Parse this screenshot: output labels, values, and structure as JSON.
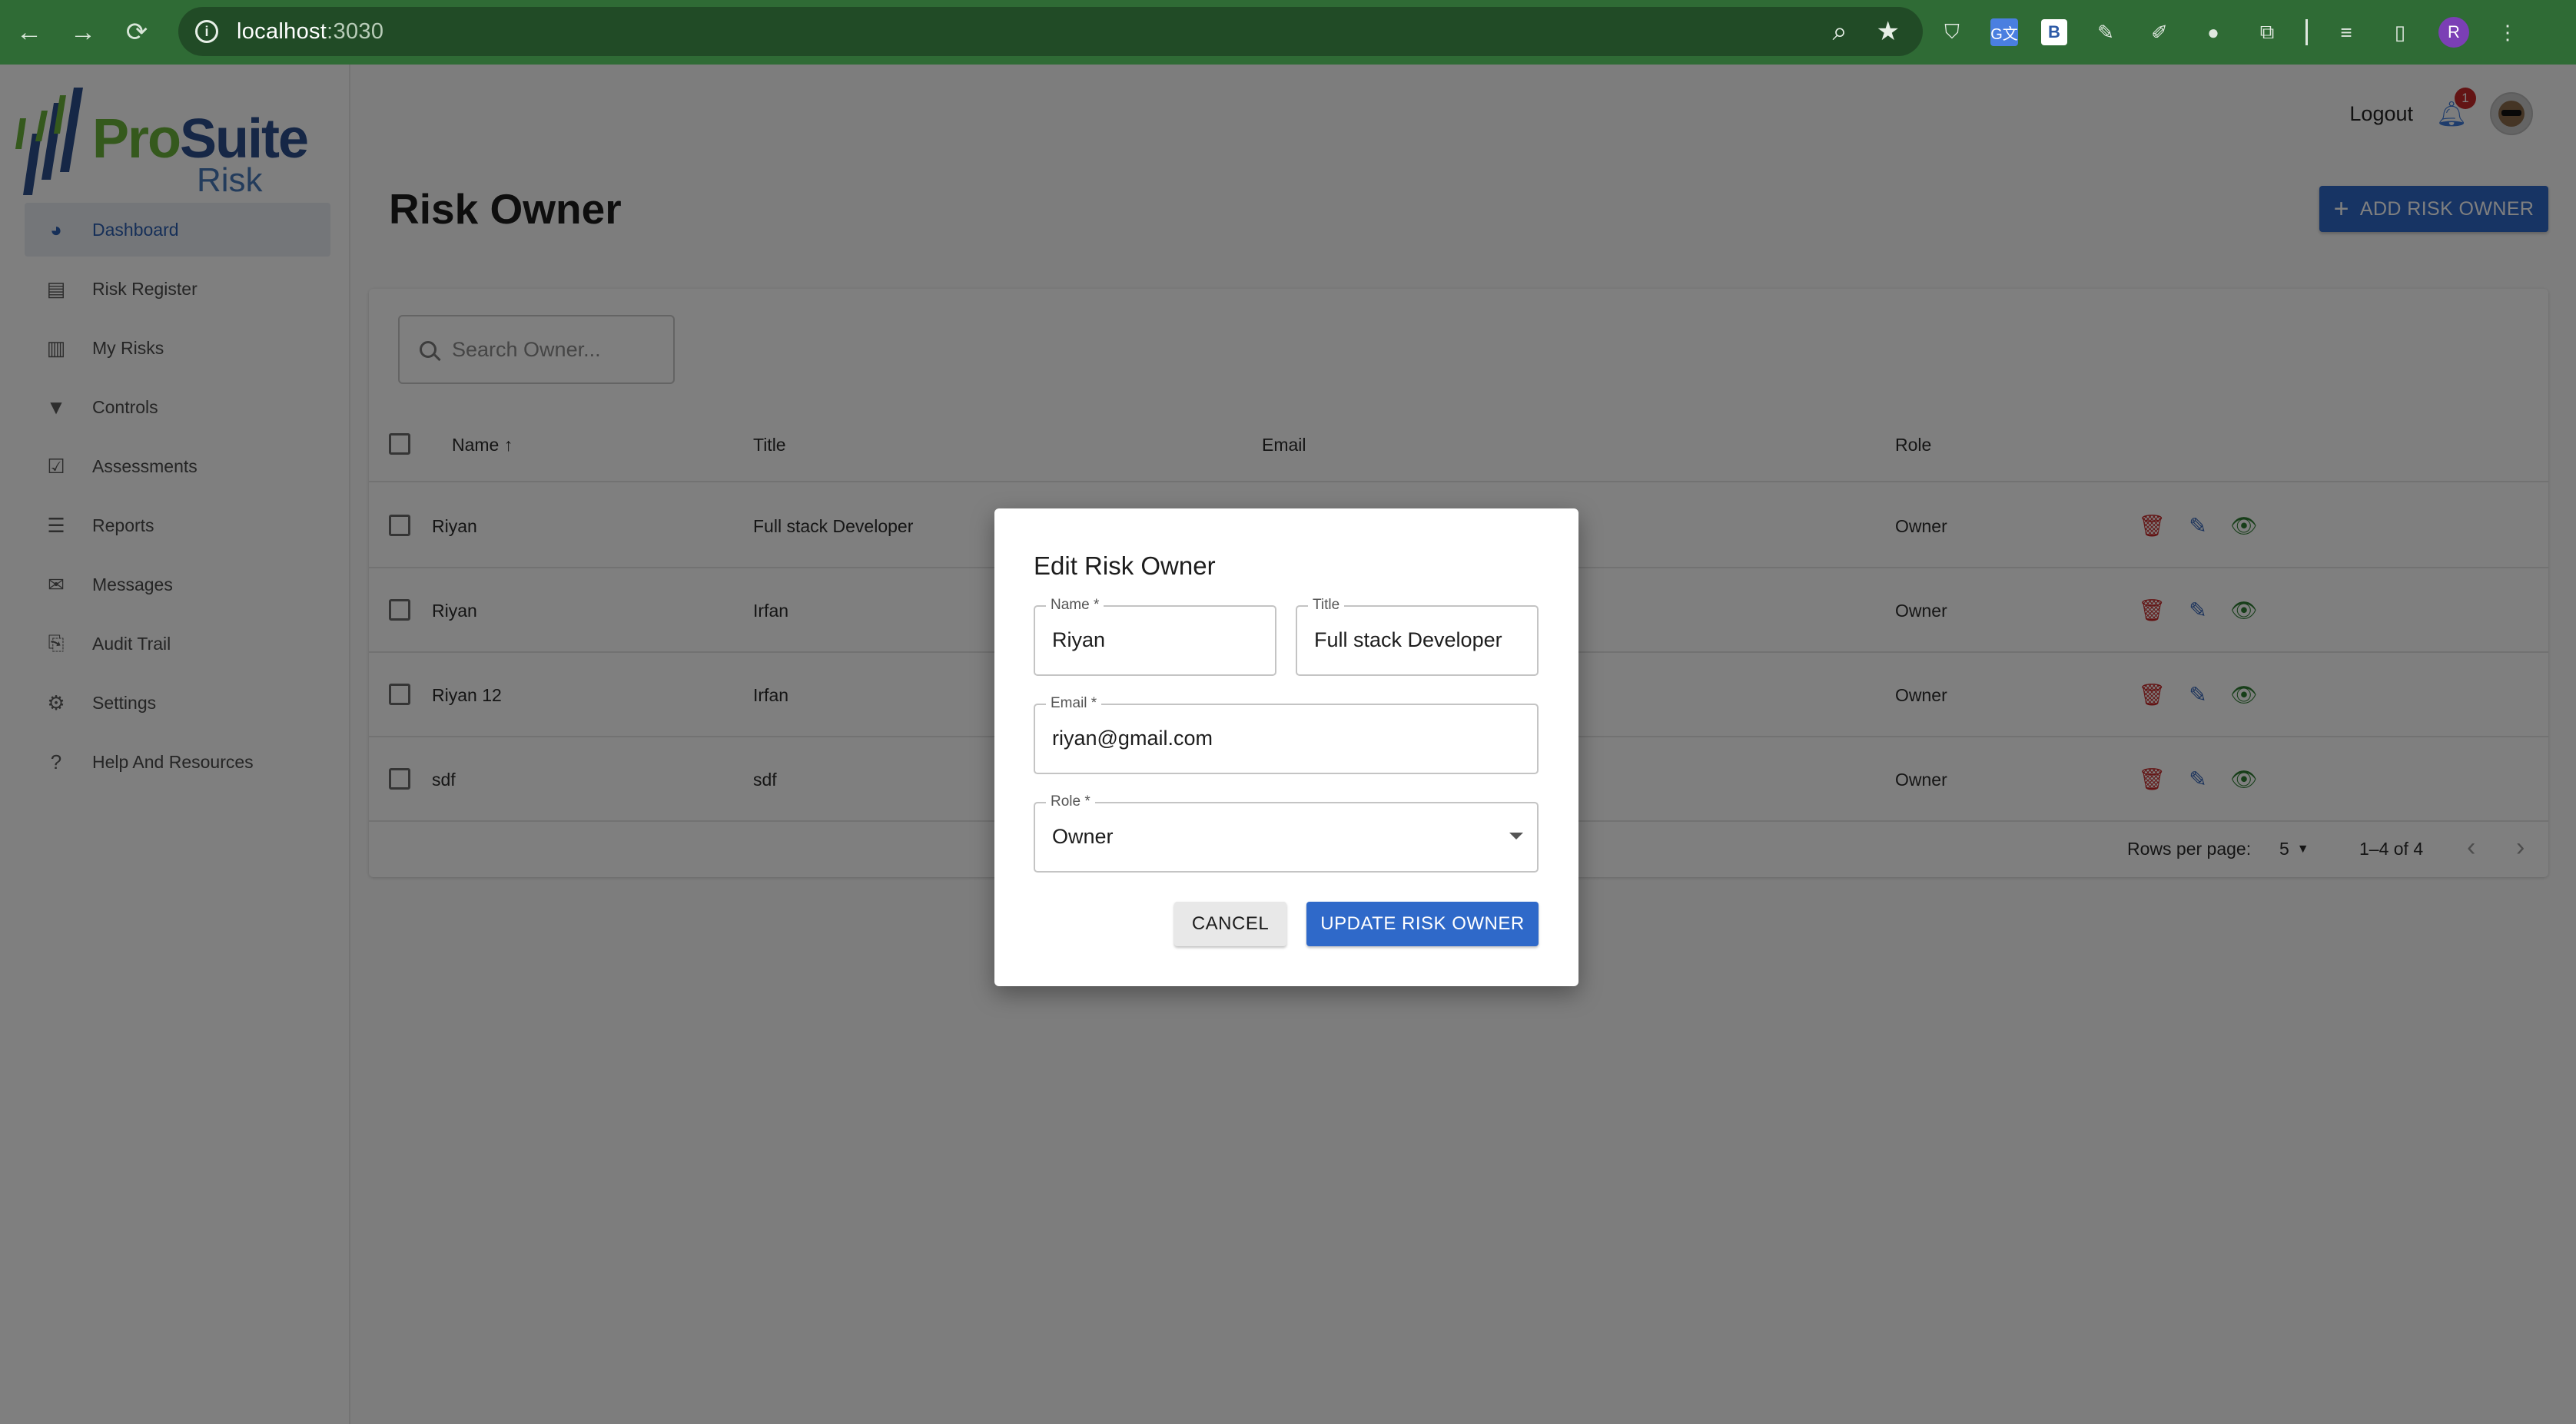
{
  "browser": {
    "url_host": "localhost",
    "url_port": ":3030",
    "profile_initial": "R",
    "ext_b_label": "B",
    "ext_translate_label": "G文"
  },
  "app": {
    "logo": {
      "pro": "Pro",
      "suite": "Suite",
      "risk": "Risk"
    },
    "sidebar": {
      "items": [
        {
          "label": "Dashboard",
          "icon": "pie-chart-icon",
          "active": true
        },
        {
          "label": "Risk Register",
          "icon": "register-icon",
          "active": false
        },
        {
          "label": "My Risks",
          "icon": "clipboard-icon",
          "active": false
        },
        {
          "label": "Controls",
          "icon": "filter-icon",
          "active": false
        },
        {
          "label": "Assessments",
          "icon": "checklist-icon",
          "active": false
        },
        {
          "label": "Reports",
          "icon": "reports-icon",
          "active": false
        },
        {
          "label": "Messages",
          "icon": "mail-icon",
          "active": false
        },
        {
          "label": "Audit Trail",
          "icon": "audit-icon",
          "active": false
        },
        {
          "label": "Settings",
          "icon": "gear-icon",
          "active": false
        },
        {
          "label": "Help And Resources",
          "icon": "help-icon",
          "active": false
        }
      ]
    },
    "header": {
      "logout_label": "Logout",
      "notification_count": "1"
    },
    "page": {
      "title": "Risk Owner",
      "add_button_label": "ADD RISK OWNER"
    },
    "search": {
      "placeholder": "Search Owner..."
    },
    "table": {
      "columns": [
        "Name",
        "Title",
        "Email",
        "Role"
      ],
      "rows": [
        {
          "name": "Riyan",
          "title": "Full stack Developer",
          "role": "Owner"
        },
        {
          "name": "Riyan",
          "title": "Irfan",
          "role": "Owner"
        },
        {
          "name": "Riyan 12",
          "title": "Irfan",
          "role": "Owner"
        },
        {
          "name": "sdf",
          "title": "sdf",
          "role": "Owner"
        }
      ]
    },
    "pagination": {
      "rows_per_page_label": "Rows per page:",
      "rows_per_page_value": "5",
      "range": "1–4 of 4"
    }
  },
  "dialog": {
    "title": "Edit Risk Owner",
    "name_label": "Name *",
    "name_value": "Riyan",
    "title_label": "Title",
    "title_value": "Full stack Developer",
    "email_label": "Email *",
    "email_value": "riyan@gmail.com",
    "role_label": "Role *",
    "role_value": "Owner",
    "cancel_label": "CANCEL",
    "update_label": "UPDATE RISK OWNER"
  },
  "colors": {
    "browser_bar": "#2f6b35",
    "primary": "#2f69c9",
    "delete": "#c62828",
    "view": "#2e7d32"
  }
}
